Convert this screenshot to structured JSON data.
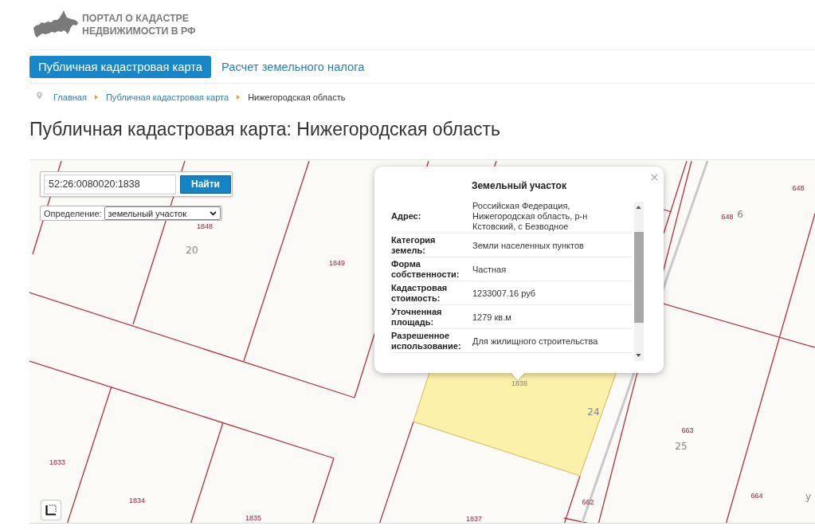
{
  "header": {
    "title_lines": [
      "ПОРТАЛ О КАДАСТРЕ",
      "НЕДВИЖИМОСТИ В РФ"
    ]
  },
  "nav": {
    "tabs": [
      {
        "label": "Публичная кадастровая карта",
        "selected": true
      },
      {
        "label": "Расчет земельного налога",
        "selected": false
      }
    ]
  },
  "breadcrumb": {
    "items": [
      {
        "label": "Главная",
        "current": false
      },
      {
        "label": "Публичная кадастровая карта",
        "current": false
      },
      {
        "label": "Нижегородская область",
        "current": true
      }
    ]
  },
  "page_title": "Публичная кадастровая карта: Нижегородская область",
  "map": {
    "search": {
      "value": "52:26:0080020:1838",
      "button": "Найти"
    },
    "mode": {
      "label": "Определение:",
      "value": "земельный участок"
    },
    "parcels": [
      {
        "number": "648",
        "selected": false
      },
      {
        "number": "648",
        "selected": false
      },
      {
        "number": "1848",
        "selected": false
      },
      {
        "number": "1849",
        "selected": false
      },
      {
        "number": "1838",
        "selected": true
      },
      {
        "number": "663",
        "selected": false
      },
      {
        "number": "1833",
        "selected": false
      },
      {
        "number": "664",
        "selected": false
      },
      {
        "number": "1834",
        "selected": false
      },
      {
        "number": "662",
        "selected": false
      },
      {
        "number": "1835",
        "selected": false
      },
      {
        "number": "1837",
        "selected": false
      }
    ],
    "blocks": [
      {
        "number": "6"
      },
      {
        "number": "20"
      },
      {
        "number": "24"
      },
      {
        "number": "25"
      }
    ],
    "edge_label": "у",
    "popup": {
      "title": "Земельный участок",
      "rows": [
        {
          "label": "Адрес:",
          "value": "Российская Федерация, Нижегородская область, р-н Кстовский, с Безводное"
        },
        {
          "label": "Категория земель:",
          "value": "Земли населенных пунктов"
        },
        {
          "label": "Форма собственности:",
          "value": "Частная"
        },
        {
          "label": "Кадастровая стоимость:",
          "value": "1233007.16 руб"
        },
        {
          "label": "Уточненная площадь:",
          "value": "1279 кв.м"
        },
        {
          "label": "Разрешенное использование:",
          "value": "Для жилищного строительства"
        }
      ]
    }
  }
}
